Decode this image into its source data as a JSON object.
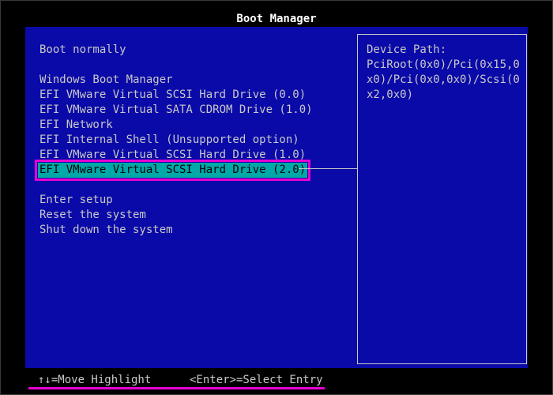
{
  "window": {
    "title": "Boot Manager"
  },
  "menu": {
    "items": [
      {
        "label": "Boot normally"
      },
      {
        "label": "Windows Boot Manager"
      },
      {
        "label": "EFI VMware Virtual SCSI Hard Drive (0.0)"
      },
      {
        "label": "EFI VMware Virtual SATA CDROM Drive (1.0)"
      },
      {
        "label": "EFI Network"
      },
      {
        "label": "EFI Internal Shell (Unsupported option)"
      },
      {
        "label": "EFI VMware Virtual SCSI Hard Drive (1.0)"
      },
      {
        "label": "EFI VMware Virtual SCSI Hard Drive (2.0)"
      },
      {
        "label": "Enter setup"
      },
      {
        "label": "Reset the system"
      },
      {
        "label": "Shut down the system"
      }
    ],
    "selected_index": 7
  },
  "details": {
    "heading": "Device Path:",
    "value": "PciRoot(0x0)/Pci(0x15,0x0)/Pci(0x0,0x0)/Scsi(0x2,0x0)"
  },
  "footer": {
    "move_hint": "↑↓=Move Highlight",
    "select_hint": "<Enter>=Select Entry"
  },
  "colors": {
    "background": "#0a0aa8",
    "text": "#c8c8c8",
    "highlight": "#00a8a8",
    "annotation": "#e800d0"
  }
}
